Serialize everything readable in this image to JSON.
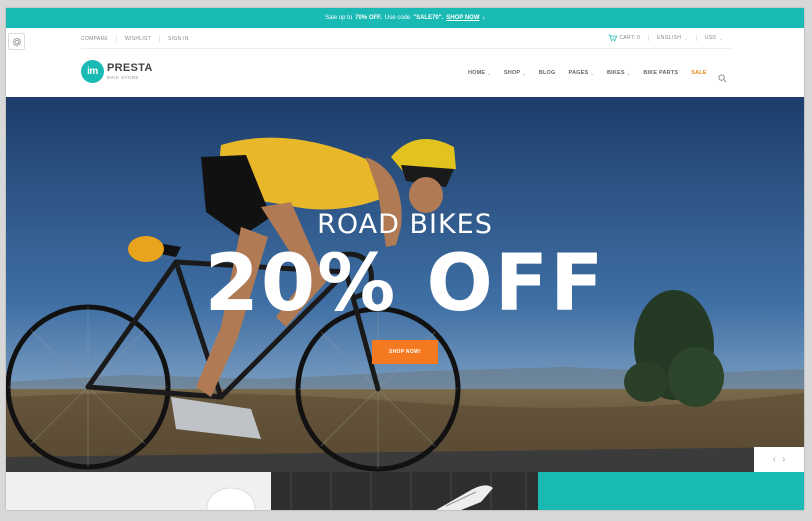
{
  "promo": {
    "prefix": "Sale up to",
    "discount": "70% OFF.",
    "code_prefix": "Use code",
    "code": "\"SALE70\".",
    "link": "SHOP NOW"
  },
  "topbar": {
    "compare": "COMPARE",
    "wishlist": "WISHLIST",
    "signin": "SIGN IN",
    "cart": "CART: 0",
    "language": "ENGLISH",
    "currency": "USD"
  },
  "logo": {
    "badge": "im",
    "name": "PRESTA",
    "tagline": "BIKE STORE"
  },
  "nav": {
    "home": "HOME",
    "shop": "SHOP",
    "blog": "BLOG",
    "pages": "PAGES",
    "bikes": "BIKES",
    "bike_parts": "BIKE PARTS",
    "sale": "SALE"
  },
  "hero": {
    "title": "ROAD BIKES",
    "discount": "20% OFF",
    "button": "SHOP NOW!"
  },
  "colors": {
    "accent": "#19b9b4",
    "cta": "#f47920",
    "sale": "#e08a1c"
  },
  "icons": {
    "settings": "gear-icon",
    "cart": "cart-icon",
    "search": "search-icon",
    "prev": "chevron-left-icon",
    "next": "chevron-right-icon"
  }
}
